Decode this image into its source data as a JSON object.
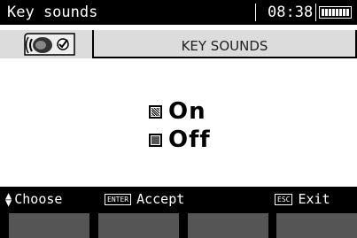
{
  "status_bar": {
    "title": "Key sounds",
    "time": "08:38",
    "battery_level": 1.0
  },
  "header": {
    "title": "KEY SOUNDS",
    "icon": "speaker-check-icon"
  },
  "options": [
    {
      "label": "On",
      "checked": true
    },
    {
      "label": "Off",
      "checked": false
    }
  ],
  "footer": {
    "choose_label": "Choose",
    "accept_key": "ENTER",
    "accept_label": "Accept",
    "exit_key": "ESC",
    "exit_label": "Exit"
  },
  "colors": {
    "background": "#000000",
    "panel": "#ffffff",
    "header_band": "#dcdcdc",
    "softkey": "#555555"
  }
}
